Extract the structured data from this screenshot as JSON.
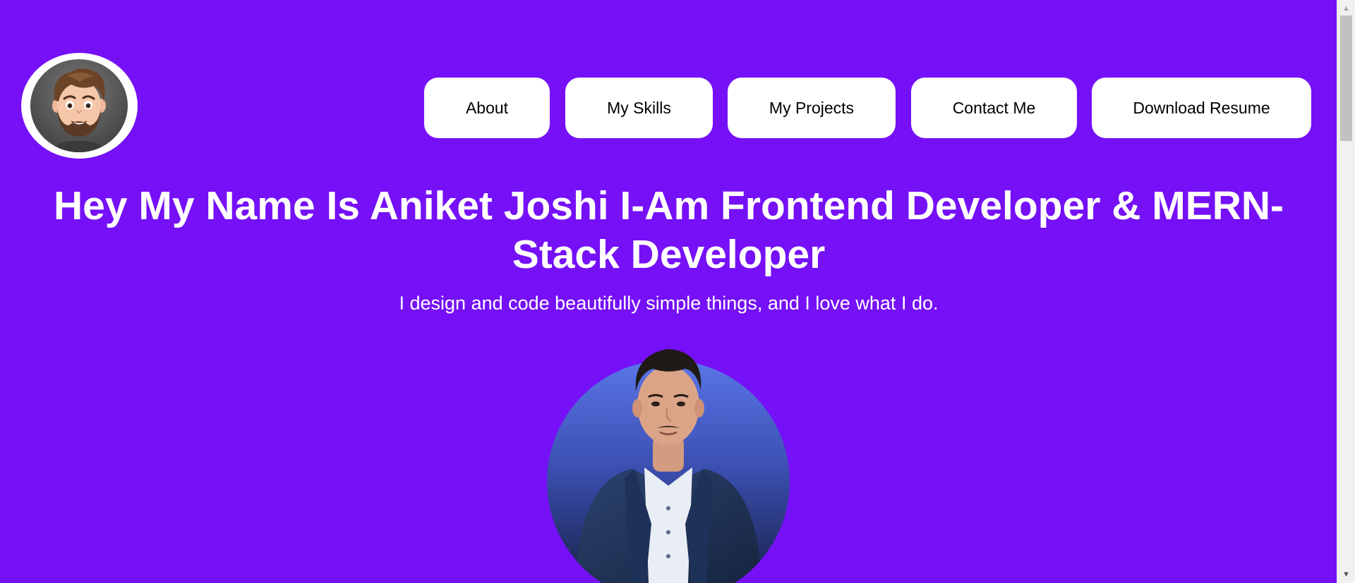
{
  "page": {
    "background_color": "#7510f7"
  },
  "logo": {
    "icon": "memoji-avatar-icon"
  },
  "nav": {
    "items": [
      {
        "label": "About"
      },
      {
        "label": "My Skills"
      },
      {
        "label": "My Projects"
      },
      {
        "label": "Contact Me"
      },
      {
        "label": "Download Resume"
      }
    ]
  },
  "hero": {
    "headline": "Hey My Name Is Aniket Joshi I-Am Frontend Developer & MERN-Stack Developer",
    "tagline": "I design and code beautifully simple things, and I love what I do.",
    "photo_icon": "profile-photo"
  },
  "scrollbar": {
    "up_icon": "▲",
    "down_icon": "▼"
  }
}
